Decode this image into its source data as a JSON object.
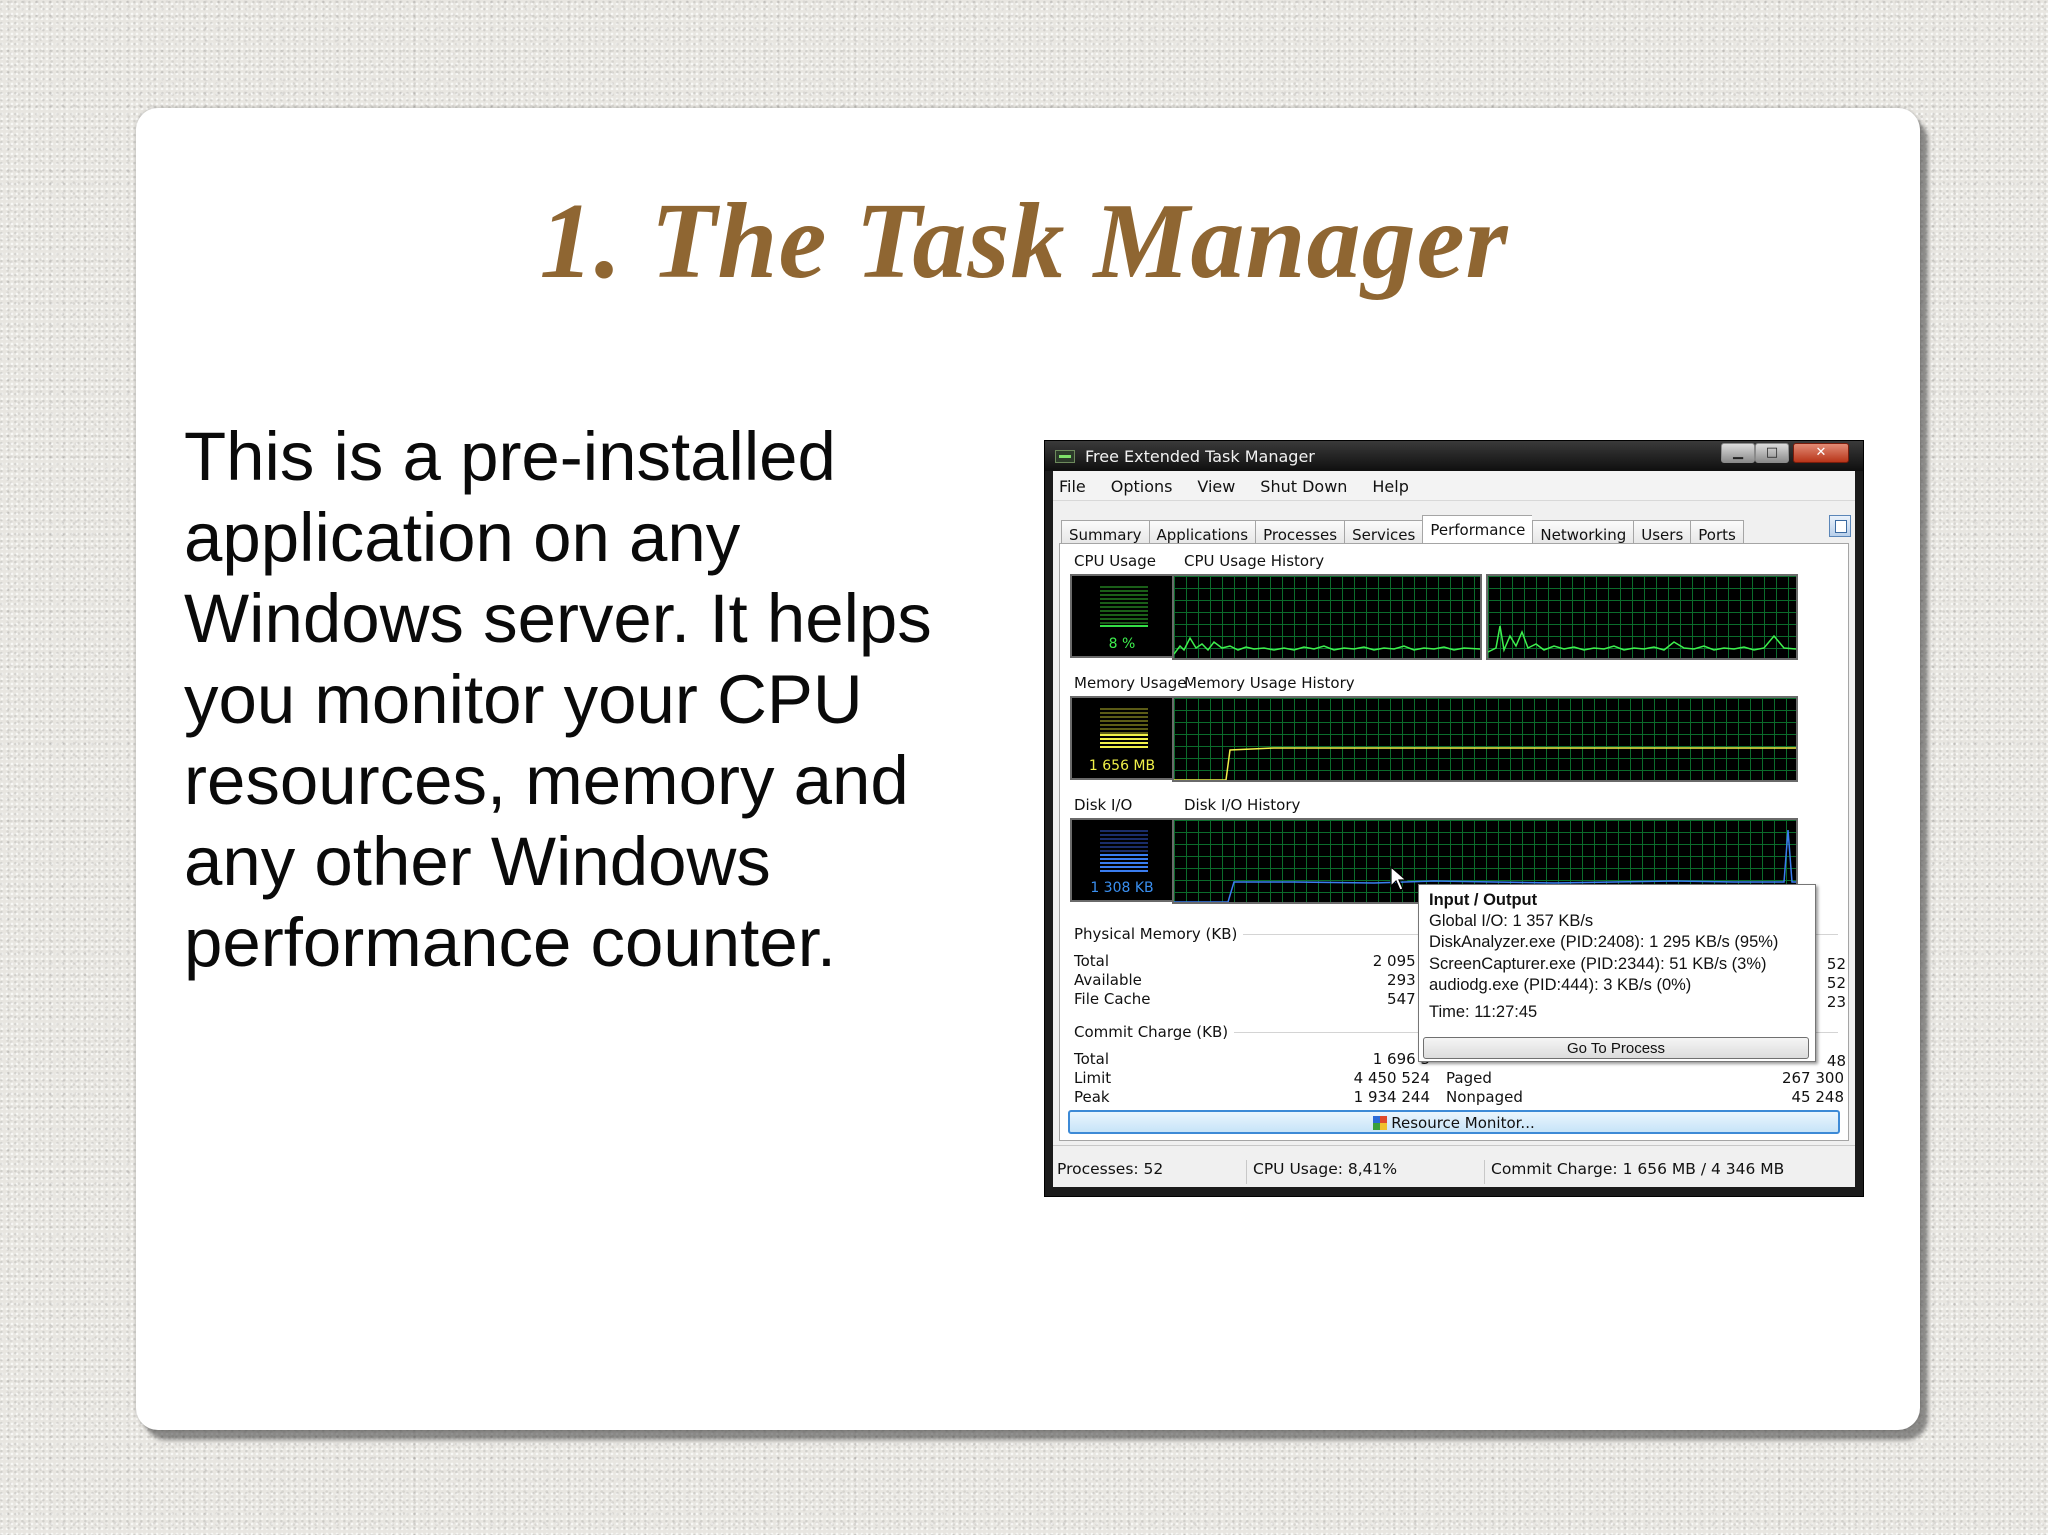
{
  "slide": {
    "title": "1. The Task Manager",
    "body_lines": [
      "This is a pre-installed",
      "application on any",
      "Windows server. It helps",
      "you monitor your CPU",
      "resources, memory and",
      "any other Windows",
      "performance counter."
    ]
  },
  "window": {
    "title": "Free Extended Task Manager",
    "controls": {
      "minimize": "▁",
      "maximize": "□",
      "close": "✕"
    },
    "menu": [
      "File",
      "Options",
      "View",
      "Shut Down",
      "Help"
    ],
    "tabs": [
      "Summary",
      "Applications",
      "Processes",
      "Services",
      "Performance",
      "Networking",
      "Users",
      "Ports"
    ],
    "active_tab": "Performance",
    "performance": {
      "cpu": {
        "label": "CPU Usage",
        "history_label": "CPU Usage History",
        "value": "8 %",
        "level": 0.08
      },
      "memory": {
        "label": "Memory Usage",
        "history_label": "Memory Usage History",
        "value": "1 656 MB",
        "level": 0.38
      },
      "disk": {
        "label": "Disk I/O",
        "history_label": "Disk I/O History",
        "value": "1 308 KB",
        "level": 0.42
      },
      "physical_memory": {
        "title": "Physical Memory (KB)",
        "rows": [
          {
            "label": "Total",
            "value": "2 095 5"
          },
          {
            "label": "Available",
            "value": "293 4"
          },
          {
            "label": "File Cache",
            "value": "547 4"
          }
        ],
        "right_values": [
          "52",
          "52",
          "23"
        ]
      },
      "commit_charge": {
        "title": "Commit Charge (KB)",
        "rows": [
          {
            "label": "Total",
            "value": "1 696 3"
          },
          {
            "label": "Limit",
            "value": "4 450 524"
          },
          {
            "label": "Peak",
            "value": "1 934 244"
          }
        ],
        "kernel_rows": [
          {
            "label": "Paged",
            "value": "267 300"
          },
          {
            "label": "Nonpaged",
            "value": "45 248"
          }
        ],
        "right_top_value": "48"
      },
      "resource_monitor_button": "Resource Monitor..."
    },
    "tooltip": {
      "title": "Input / Output",
      "lines": [
        "Global I/O: 1 357 KB/s",
        "DiskAnalyzer.exe (PID:2408): 1 295 KB/s (95%)",
        "ScreenCapturer.exe (PID:2344): 51 KB/s (3%)",
        "audiodg.exe (PID:444): 3 KB/s (0%)"
      ],
      "time": "Time: 11:27:45",
      "button": "Go To Process"
    },
    "status": {
      "processes": "Processes: 52",
      "cpu": "CPU Usage: 8,41%",
      "commit": "Commit Charge: 1 656 MB / 4 346 MB"
    }
  }
}
